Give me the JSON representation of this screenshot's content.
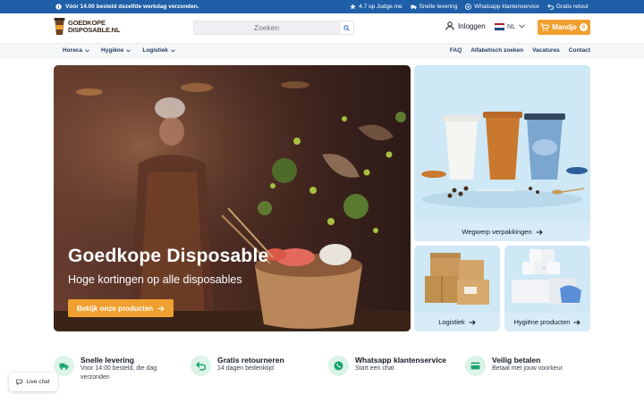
{
  "topbar": {
    "left_text": "Vóór 14.00 besteld dezelfde werkdag verzonden.",
    "items": [
      {
        "icon": "star-icon",
        "label": "4.7 op Judge.me"
      },
      {
        "icon": "truck-icon",
        "label": "Snelle levering"
      },
      {
        "icon": "whatsapp-icon",
        "label": "Whatsapp klantenservice"
      },
      {
        "icon": "return-icon",
        "label": "Gratis retour"
      }
    ]
  },
  "header": {
    "logo_line1": "GOEDKOPE",
    "logo_line2": "DISPOSABLE.NL",
    "search_placeholder": "Zoeken",
    "login_label": "Inloggen",
    "language": "NL",
    "cart_label": "Mandje",
    "cart_count": "0"
  },
  "nav": {
    "left": [
      {
        "label": "Horeca"
      },
      {
        "label": "Hygiëne"
      },
      {
        "label": "Logistiek"
      }
    ],
    "right": [
      {
        "label": "FAQ"
      },
      {
        "label": "Alfabetisch zoeken"
      },
      {
        "label": "Vacatures"
      },
      {
        "label": "Contact"
      }
    ]
  },
  "hero": {
    "title": "Goedkope Disposable",
    "subtitle": "Hoge kortingen op alle disposables",
    "cta_label": "Bekijk onze producten"
  },
  "tiles": {
    "wegwerp": "Wegwerp verpakkingen",
    "logistiek": "Logistiek",
    "hygiene": "Hygiëne producten"
  },
  "usps": [
    {
      "icon": "truck-icon",
      "title": "Snelle levering",
      "desc": "Voor 14:00 besteld, die dag verzonden"
    },
    {
      "icon": "return-icon",
      "title": "Gratis retourneren",
      "desc": "14 dagen bedenktijd"
    },
    {
      "icon": "whatsapp-icon",
      "title": "Whatsapp klantenservice",
      "desc": "Start een chat"
    },
    {
      "icon": "payment-icon",
      "title": "Veilig betalen",
      "desc": "Betaal met jouw voorkeur"
    }
  ],
  "livechat_label": "Live chat",
  "colors": {
    "topbar": "#1f5fa8",
    "accent": "#f0a030",
    "tile_bg": "#cfe8f5",
    "usp_icon": "#1aa36b"
  }
}
